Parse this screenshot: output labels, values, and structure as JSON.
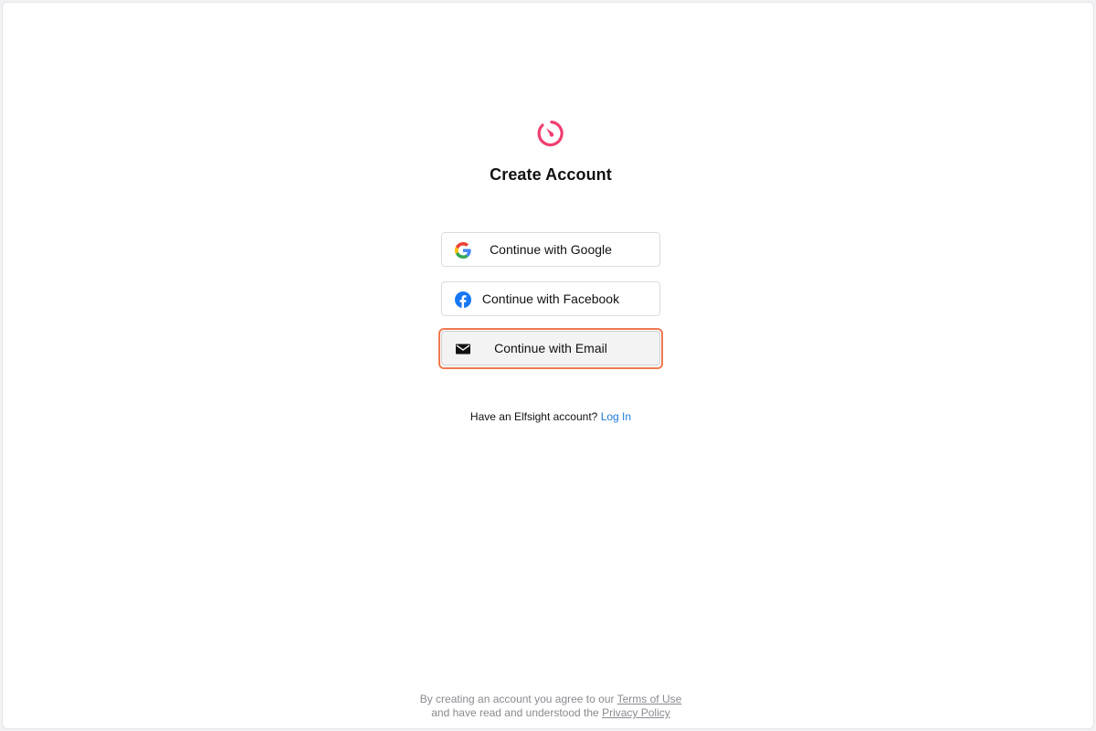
{
  "brand": {
    "logo_icon": "elfsight-logo-icon",
    "accent": "#f03e70"
  },
  "page": {
    "title": "Create Account"
  },
  "auth_buttons": [
    {
      "label": "Continue with Google",
      "icon": "google-icon"
    },
    {
      "label": "Continue with Facebook",
      "icon": "facebook-icon",
      "color": "#1877f2"
    },
    {
      "label": "Continue with Email",
      "icon": "envelope-icon",
      "focused": true
    }
  ],
  "login_prompt": {
    "text": "Have an Elfsight account?",
    "link_label": "Log In",
    "link_color": "#1e7ad6"
  },
  "legal": {
    "line1_prefix": "By creating an account you agree to our",
    "terms_label": "Terms of Use",
    "line2_prefix": "and have read and understood the",
    "privacy_label": "Privacy Policy"
  },
  "focus_ring_color": "#ef7a4f"
}
